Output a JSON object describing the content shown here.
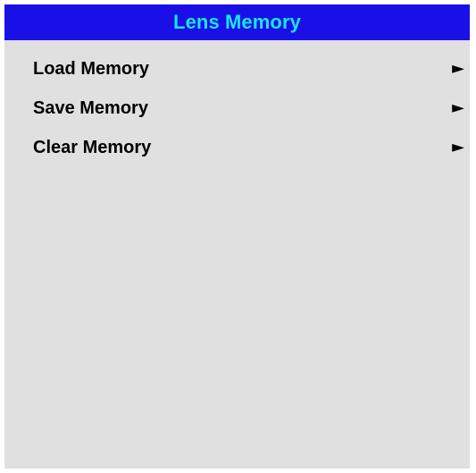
{
  "window": {
    "title": "Lens Memory"
  },
  "menu": {
    "items": [
      {
        "label": "Load Memory",
        "arrow": "►",
        "icon": "submenu-arrow-icon"
      },
      {
        "label": "Save Memory",
        "arrow": "►",
        "icon": "submenu-arrow-icon"
      },
      {
        "label": "Clear Memory",
        "arrow": "►",
        "icon": "submenu-arrow-icon"
      }
    ]
  },
  "colors": {
    "title_bar_bg": "#1a0fe6",
    "title_text": "#16e6f2",
    "panel_bg": "#e0e0e0",
    "item_text": "#000000"
  }
}
